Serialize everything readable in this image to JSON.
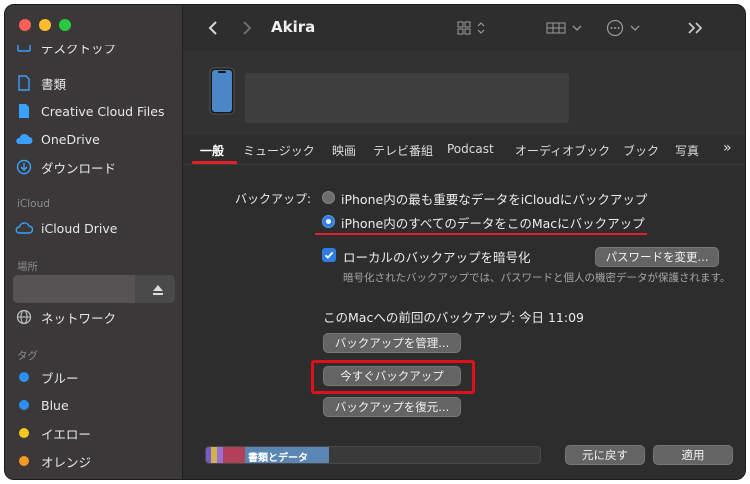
{
  "window": {
    "title": "Akira"
  },
  "sidebar": {
    "favorites": [
      {
        "label": "デスクトップ",
        "icon": "desktop-icon"
      },
      {
        "label": "書類",
        "icon": "document-icon"
      },
      {
        "label": "Creative Cloud Files",
        "icon": "file-icon"
      },
      {
        "label": "OneDrive",
        "icon": "cloud-icon"
      },
      {
        "label": "ダウンロード",
        "icon": "download-icon"
      }
    ],
    "icloud_header": "iCloud",
    "icloud_items": [
      {
        "label": "iCloud Drive",
        "icon": "cloud-icon"
      }
    ],
    "locations_header": "場所",
    "locations_items": [
      {
        "label": "ネットワーク",
        "icon": "globe-icon"
      }
    ],
    "tags_header": "タグ",
    "tags": [
      {
        "label": "ブルー",
        "color": "#2f8ff0"
      },
      {
        "label": "Blue",
        "color": "#2f8ff0"
      },
      {
        "label": "イエロー",
        "color": "#f4c81f"
      },
      {
        "label": "オレンジ",
        "color": "#f39a20"
      }
    ]
  },
  "tabs": [
    "一般",
    "ミュージック",
    "映画",
    "テレビ番組",
    "Podcast",
    "オーディオブック",
    "ブック",
    "写真"
  ],
  "general": {
    "backup_label": "バックアップ:",
    "option_icloud": "iPhone内の最も重要なデータをiCloudにバックアップ",
    "option_mac": "iPhone内のすべてのデータをこのMacにバックアップ",
    "encrypt_label": "ローカルのバックアップを暗号化",
    "encrypt_checked": true,
    "change_password_button": "パスワードを変更...",
    "encrypt_note": "暗号化されたバックアップでは、パスワードと個人の機密データが保護されます。",
    "last_backup": "このMacへの前回のバックアップ: 今日 11:09",
    "manage_button": "バックアップを管理...",
    "backup_now_button": "今すぐバックアップ",
    "restore_button": "バックアップを復元..."
  },
  "storage": {
    "segment_label": "書類とデータ"
  },
  "footer": {
    "revert_button": "元に戻す",
    "apply_button": "適用"
  },
  "colors": {
    "accent": "#2f7de1",
    "highlight": "#e0202a"
  }
}
